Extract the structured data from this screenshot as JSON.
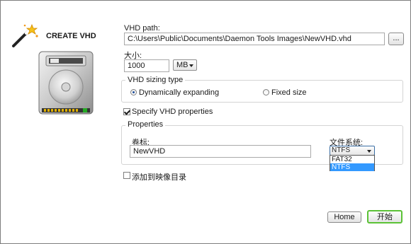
{
  "header": {
    "title": "CREATE VHD"
  },
  "vhd_path": {
    "label": "VHD path:",
    "value": "C:\\Users\\Public\\Documents\\Daemon Tools Images\\NewVHD.vhd",
    "browse_label": "..."
  },
  "size": {
    "label": "大小:",
    "value": "1000",
    "unit": "MB"
  },
  "sizing": {
    "legend": "VHD sizing type",
    "dynamic_label": "Dynamically expanding",
    "fixed_label": "Fixed size",
    "selected": "dynamic"
  },
  "specify": {
    "label": "Specify VHD properties",
    "checked": true
  },
  "properties": {
    "legend": "Properties",
    "volume_label": "卷标:",
    "volume_value": "NewVHD",
    "fs_label": "文件系统:",
    "fs_value": "NTFS",
    "fs_options": [
      "FAT32",
      "NTFS"
    ]
  },
  "add_to_catalog": {
    "label": "添加到映像目录",
    "checked": false
  },
  "footer": {
    "home_label": "Home",
    "start_label": "开始"
  },
  "colors": {
    "start_border": "#5bc236",
    "dropdown_selected": "#3399ff"
  }
}
